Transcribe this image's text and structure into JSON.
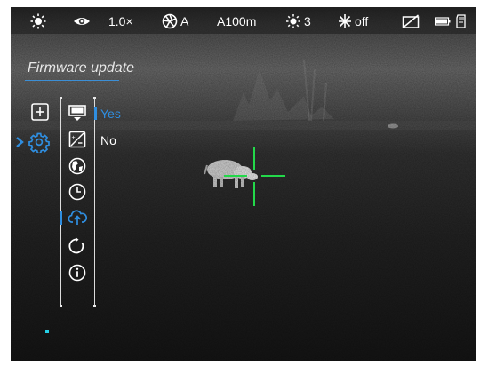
{
  "status_bar": {
    "brightness_icon": "sun-icon",
    "eye_icon": "eye-icon",
    "zoom": "1.0×",
    "calibration_icon": "shutter-icon",
    "calibration_mode": "A",
    "rangefinder": "A100m",
    "contrast_icon": "sun-small-icon",
    "contrast_level": "3",
    "ir_icon": "star-burst-icon",
    "ir_state": "off",
    "pip_off_icon": "picture-in-picture-off-icon",
    "battery_icon": "battery-icon",
    "sd_card_icon": "sd-card-icon"
  },
  "menu": {
    "title": "Firmware update",
    "left_icons": [
      {
        "name": "add-icon",
        "selected": false
      },
      {
        "name": "gear-icon",
        "selected": true
      }
    ],
    "submenu_icons": [
      {
        "name": "display-settings-icon",
        "selected": false
      },
      {
        "name": "image-settings-icon",
        "selected": false
      },
      {
        "name": "globe-icon",
        "selected": false
      },
      {
        "name": "clock-icon",
        "selected": false
      },
      {
        "name": "cloud-upload-icon",
        "selected": true
      },
      {
        "name": "reset-icon",
        "selected": false
      },
      {
        "name": "info-icon",
        "selected": false
      }
    ],
    "options": [
      {
        "label": "Yes",
        "selected": true
      },
      {
        "label": "No",
        "selected": false
      }
    ]
  },
  "colors": {
    "accent": "#2f8ee0",
    "reticle": "#23d84a",
    "text": "#ffffff"
  }
}
